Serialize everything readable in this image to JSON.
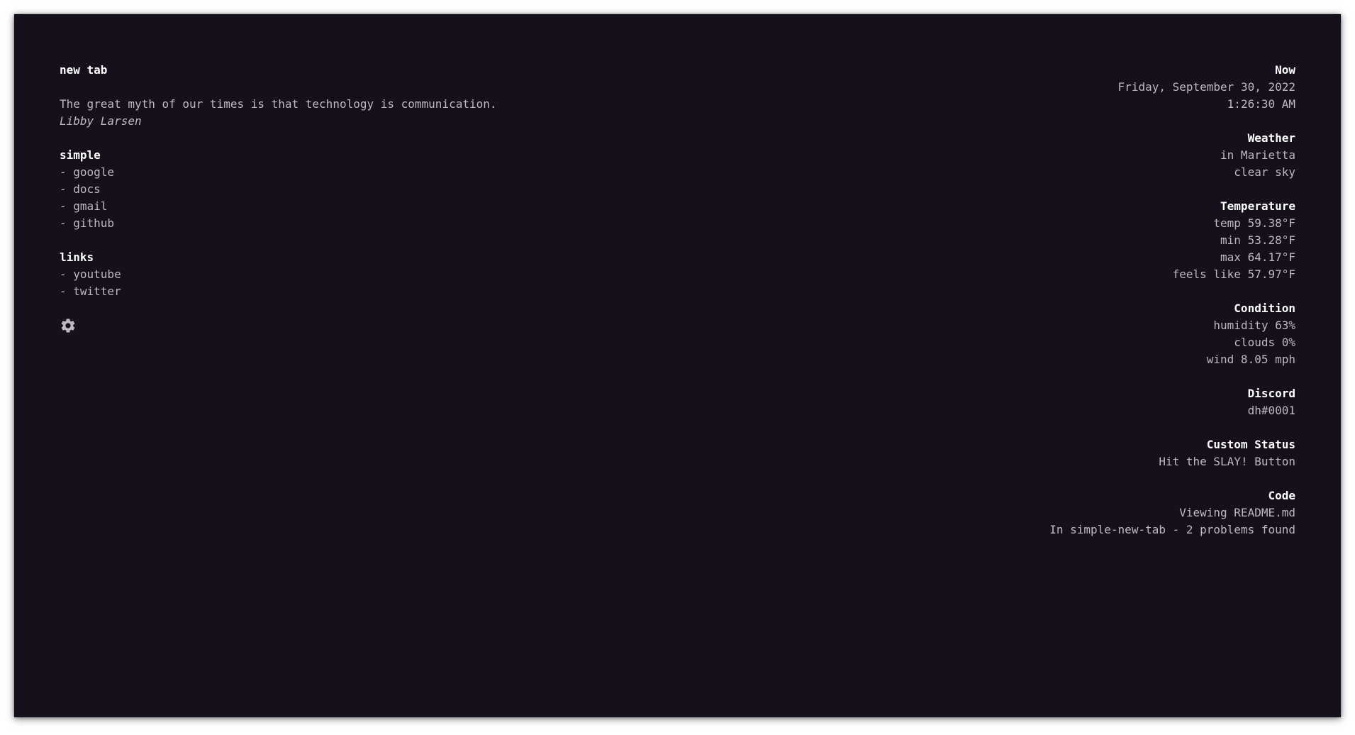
{
  "page": {
    "title": "new tab",
    "quote": {
      "text": "The great myth of our times is that technology is communication.",
      "author": "Libby Larsen"
    }
  },
  "sections": [
    {
      "title": "simple",
      "items": [
        "- google",
        "- docs",
        "- gmail",
        "- github"
      ]
    },
    {
      "title": "links",
      "items": [
        "- youtube",
        "- twitter"
      ]
    }
  ],
  "settings": {
    "icon": "gear-icon"
  },
  "widgets": {
    "now": {
      "title": "Now",
      "date": "Friday, September 30, 2022",
      "time": "1:26:30 AM"
    },
    "weather": {
      "title": "Weather",
      "location": "in Marietta",
      "description": "clear sky"
    },
    "temperature": {
      "title": "Temperature",
      "temp": "temp 59.38°F",
      "min": "min 53.28°F",
      "max": "max 64.17°F",
      "feels_like": "feels like 57.97°F"
    },
    "condition": {
      "title": "Condition",
      "humidity": "humidity 63%",
      "clouds": "clouds 0%",
      "wind": "wind 8.05 mph"
    },
    "discord": {
      "title": "Discord",
      "user": "dh#0001"
    },
    "custom_status": {
      "title": "Custom Status",
      "text": "Hit the SLAY! Button"
    },
    "code": {
      "title": "Code",
      "file": "Viewing README.md",
      "project": "In simple-new-tab - 2 problems found"
    }
  },
  "colors": {
    "background": "#16101c",
    "text": "#bdb9c3",
    "heading": "#ffffff"
  }
}
